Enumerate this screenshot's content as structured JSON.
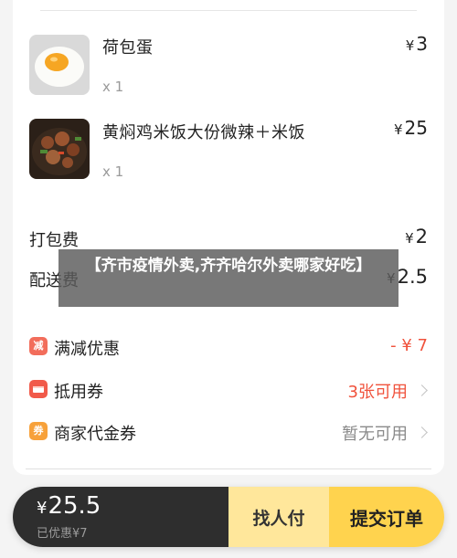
{
  "items": [
    {
      "name": "荷包蛋",
      "qty": "x 1",
      "currency": "¥",
      "price": "3"
    },
    {
      "name": "黄焖鸡米饭大份微辣＋米饭",
      "qty": "x 1",
      "currency": "¥",
      "price": "25"
    }
  ],
  "fees": [
    {
      "label": "打包费",
      "currency": "¥",
      "price": "2"
    },
    {
      "label": "配送费",
      "currency": "¥",
      "price": "2.5"
    }
  ],
  "promos": [
    {
      "icon_text": "减",
      "icon": "discount-icon",
      "icon_color": "#f26d5b",
      "label": "满减优惠",
      "value": "- ¥ 7",
      "value_color": "#f0523c"
    },
    {
      "icon_text": "",
      "icon": "coupon-icon",
      "icon_color": "#f15a4a",
      "label": "抵用券",
      "value": "3张可用",
      "value_color": "#f0523c"
    },
    {
      "icon_text": "券",
      "icon": "merchant-voucher-icon",
      "icon_color": "#f7a13a",
      "label": "商家代金券",
      "value": "暂无可用",
      "value_color": "#8a8a8a"
    }
  ],
  "overlay": {
    "title": "【齐市疫情外卖,齐齐哈尔外卖哪家好吃】"
  },
  "cart": {
    "currency": "¥",
    "total": "25.5",
    "discount": "已优惠¥7",
    "find_pay": "找人付",
    "submit": "提交订单"
  }
}
